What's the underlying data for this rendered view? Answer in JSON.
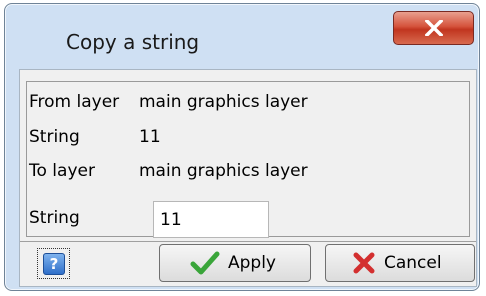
{
  "window": {
    "title": "Copy a string"
  },
  "fields": [
    {
      "label": "From layer",
      "value": "main graphics layer"
    },
    {
      "label": "String",
      "value": "11"
    },
    {
      "label": "To layer",
      "value": "main graphics layer"
    },
    {
      "label": "String",
      "value": "11"
    }
  ],
  "buttons": {
    "apply_label": "Apply",
    "cancel_label": "Cancel"
  },
  "icons": {
    "close": "close-icon",
    "help": "help-icon",
    "apply": "checkmark-icon",
    "cancel": "cross-icon"
  },
  "colors": {
    "title_bar": "#cfe0f3",
    "close_button": "#c1351f",
    "checkmark": "#3aa53a",
    "cross": "#d32f2f"
  }
}
